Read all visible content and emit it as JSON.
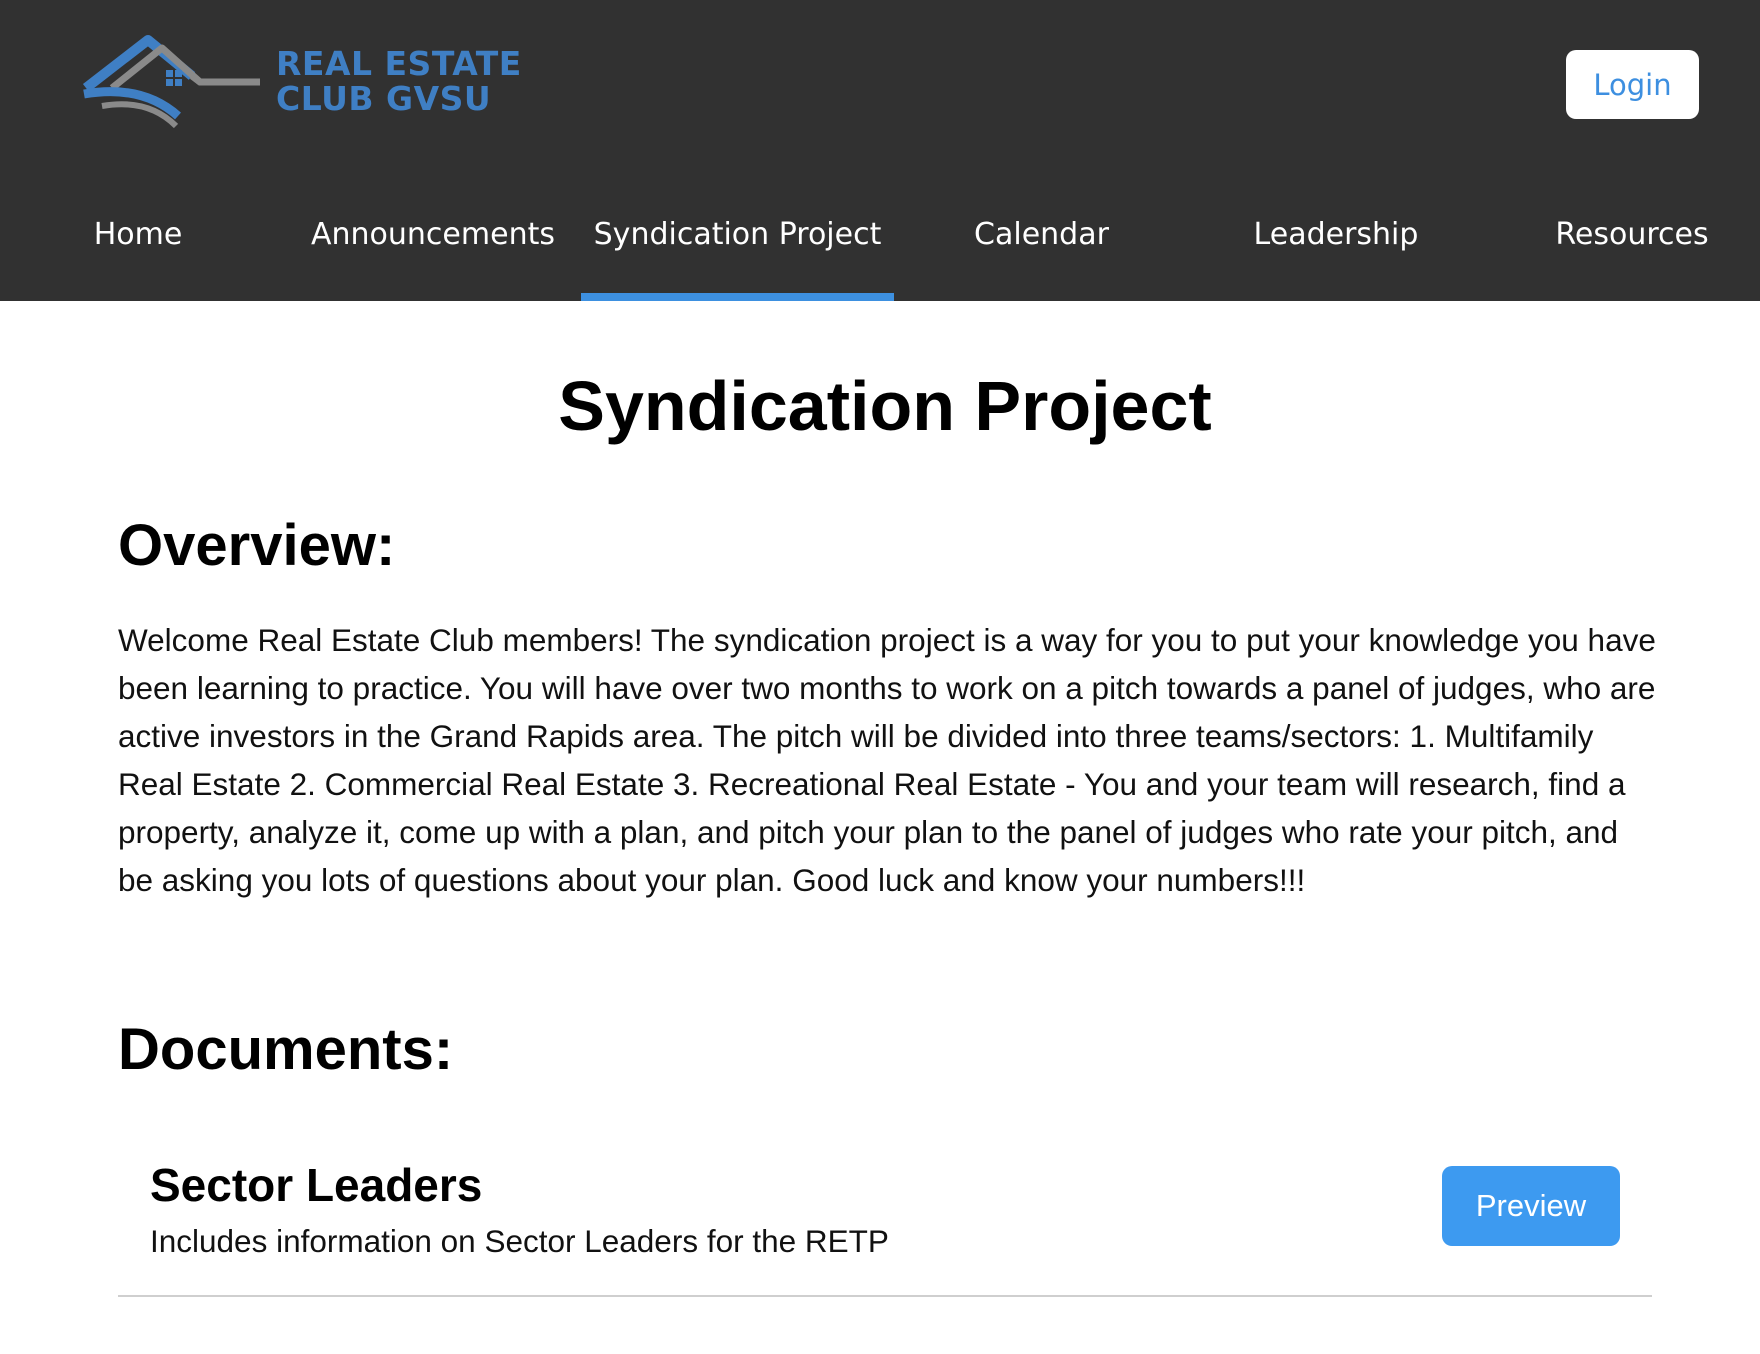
{
  "header": {
    "logo": {
      "line1": "REAL ESTATE",
      "line2": "CLUB GVSU"
    },
    "login_label": "Login"
  },
  "nav": {
    "items": [
      {
        "label": "Home"
      },
      {
        "label": "Announcements"
      },
      {
        "label": "Syndication Project",
        "active": true
      },
      {
        "label": "Calendar"
      },
      {
        "label": "Leadership"
      },
      {
        "label": "Resources"
      }
    ]
  },
  "main": {
    "title": "Syndication Project",
    "overview": {
      "heading": "Overview:",
      "text": "Welcome Real Estate Club members! The syndication project is a way for you to put your knowledge you have been learning to practice. You will have over two months to work on a pitch towards a panel of judges, who are active investors in the Grand Rapids area. The pitch will be divided into three teams/sectors: 1. Multifamily Real Estate 2. Commercial Real Estate 3. Recreational Real Estate - You and your team will research, find a property, analyze it, come up with a plan, and pitch your plan to the panel of judges who rate your pitch, and be asking you lots of questions about your plan. Good luck and know your numbers!!!"
    },
    "documents": {
      "heading": "Documents:",
      "items": [
        {
          "title": "Sector Leaders",
          "description": "Includes information on Sector Leaders for the RETP",
          "button_label": "Preview"
        }
      ]
    }
  },
  "colors": {
    "header_bg": "#313131",
    "accent": "#3d90e0",
    "button_bg": "#3d9af0"
  }
}
